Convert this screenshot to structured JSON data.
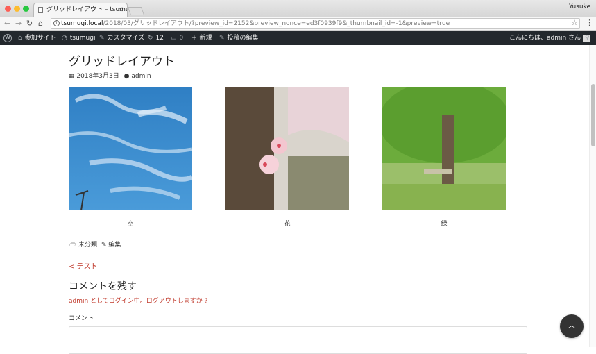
{
  "browser": {
    "tab_title": "グリッドレイアウト – tsumugi",
    "profile_name": "Yusuke",
    "url_host": "tsumugi.local",
    "url_path": "/2018/03/グリッドレイアウト/?preview_id=2152&preview_nonce=ed3f0939f9&_thumbnail_id=-1&preview=true"
  },
  "adminbar": {
    "site_label": "参加サイト",
    "site_name": "tsumugi",
    "customize_label": "カスタマイズ",
    "updates_count": "12",
    "comments_count": "0",
    "new_label": "新規",
    "edit_label": "投稿の編集",
    "greeting": "こんにちは、admin さん"
  },
  "post": {
    "title": "グリッドレイアウト",
    "date": "2018年3月3日",
    "author": "admin",
    "gallery": [
      {
        "caption": "空"
      },
      {
        "caption": "花"
      },
      {
        "caption": "緑"
      }
    ],
    "category": "未分類",
    "edit_link": "編集",
    "prev_link": "< テスト"
  },
  "comment": {
    "heading": "コメントを残す",
    "logged_in_text": "admin としてログイン中。ログアウトしますか ?",
    "field_label": "コメント"
  },
  "colors": {
    "adminbar_bg": "#23282d",
    "link_red": "#c0392b"
  }
}
